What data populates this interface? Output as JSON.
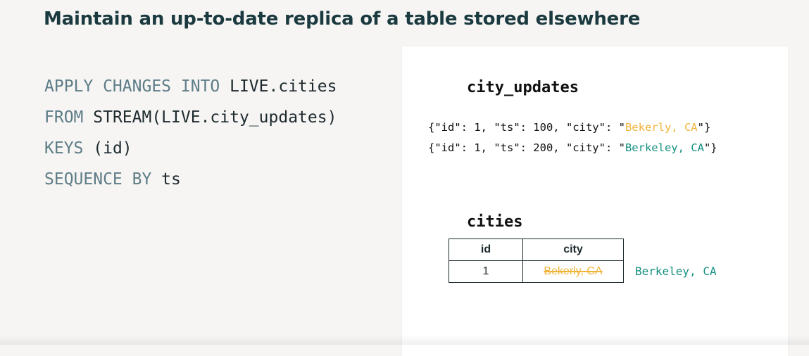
{
  "title": "Maintain an up-to-date replica of a table stored elsewhere",
  "code": {
    "lines": [
      {
        "keyword": "APPLY CHANGES INTO ",
        "identifier": "LIVE.cities"
      },
      {
        "keyword": "FROM ",
        "identifier": "STREAM(LIVE.city_updates)"
      },
      {
        "keyword": "KEYS ",
        "identifier": "(id)"
      },
      {
        "keyword": "SEQUENCE BY ",
        "identifier": "ts"
      }
    ]
  },
  "updates": {
    "heading": "city_updates",
    "records": [
      {
        "prefix": "{\"id\": 1, \"ts\": 100, \"city\": \"",
        "value": "Bekerly, CA",
        "suffix": "\"}"
      },
      {
        "prefix": "{\"id\": 1, \"ts\": 200, \"city\": \"",
        "value": "Berkeley, CA",
        "suffix": "\"}"
      }
    ]
  },
  "cities": {
    "heading": "cities",
    "columns": [
      "id",
      "city"
    ],
    "row": {
      "id": "1",
      "city_old": "Bekerly, CA"
    },
    "new_value": "Berkeley, CA"
  },
  "colors": {
    "old_value": "#f0b43a",
    "new_value": "#14907f",
    "keyword": "#5e7d87",
    "title": "#1b3a3f"
  }
}
